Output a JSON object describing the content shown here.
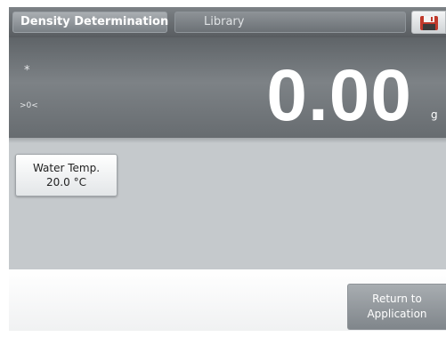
{
  "header": {
    "title": "Density Determination",
    "library_label": "Library",
    "save_icon": "floppy-disk-icon"
  },
  "reading": {
    "stable_indicator": "*",
    "zero_indicator": ">0<",
    "value": "0.00",
    "unit": "g"
  },
  "water_temp": {
    "label": "Water Temp.",
    "value": "20.0 °C"
  },
  "return_button": {
    "line1": "Return to",
    "line2": "Application"
  },
  "colors": {
    "header_bg": "#6b7074",
    "reading_bg": "#72777b",
    "middle_bg": "#c5c9cc",
    "button_text": "#ffffff"
  }
}
